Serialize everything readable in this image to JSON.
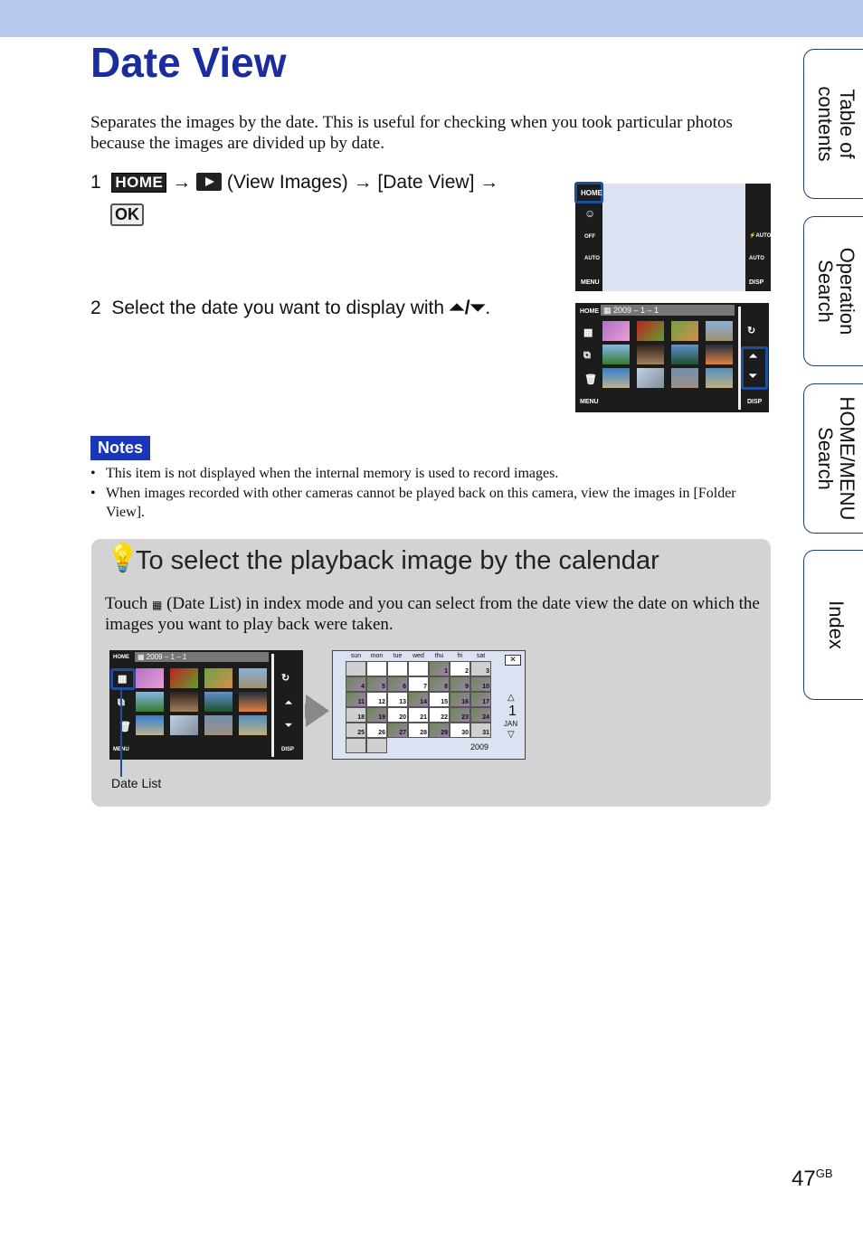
{
  "page": {
    "title": "Date View",
    "intro": "Separates the images by the date. This is useful for checking when you took particular photos because the images are divided up by date.",
    "page_number": "47",
    "page_suffix": "GB"
  },
  "steps": [
    {
      "num": "1",
      "home_key": "HOME",
      "arrow": "→",
      "view_images": "(View Images)",
      "date_view": "[Date View]",
      "ok_key": "OK"
    },
    {
      "num": "2",
      "text": "Select the date you want to display with",
      "buttons": "⏶/⏷",
      "end": "."
    }
  ],
  "screen1": {
    "home": "HOME",
    "menu": "MENU",
    "disp": "DISP",
    "flash": "⚡AUTO",
    "wb": "AUTO",
    "smile": "☺",
    "selftimer": "OFF",
    "iso": "AUTO"
  },
  "screen2": {
    "home": "HOME",
    "date": "2009 – 1 – 1",
    "menu": "MENU",
    "disp": "DISP"
  },
  "notes": {
    "label": "Notes",
    "items": [
      "This item is not displayed when the internal memory is used to record images.",
      "When images recorded with other cameras cannot be played back on this camera, view the images in [Folder View]."
    ]
  },
  "tip": {
    "title": "To select the playback image by the calendar",
    "text_before": "Touch",
    "text_after": "(Date List) in index mode and you can select from the date view the date on which the images you want to play back were taken.",
    "callout": "Date List"
  },
  "calendar": {
    "days": [
      "sun",
      "mon",
      "tue",
      "wed",
      "thu",
      "fri",
      "sat"
    ],
    "year": "2009",
    "month": "JAN",
    "month_num": "1",
    "up": "△",
    "down": "▽",
    "close": "✕",
    "weeks": [
      [
        "",
        "",
        "",
        "",
        "1",
        "2",
        "3"
      ],
      [
        "4",
        "5",
        "6",
        "7",
        "8",
        "9",
        "10"
      ],
      [
        "11",
        "12",
        "13",
        "14",
        "15",
        "16",
        "17"
      ],
      [
        "18",
        "19",
        "20",
        "21",
        "22",
        "23",
        "24"
      ],
      [
        "25",
        "26",
        "27",
        "28",
        "29",
        "30",
        "31"
      ],
      [
        "",
        ""
      ]
    ],
    "photo_days": [
      "1",
      "4",
      "5",
      "6",
      "8",
      "9",
      "10",
      "11",
      "14",
      "16",
      "17",
      "19",
      "23",
      "24",
      "27",
      "29"
    ]
  },
  "tabs": [
    "Table of\ncontents",
    "Operation\nSearch",
    "HOME/MENU\nSearch",
    "Index"
  ],
  "colors": {
    "title": "#1b2d9e",
    "highlight": "#1f4f9a",
    "notes_bg": "#1b35b8",
    "tip_bg": "#d3d3d3",
    "band": "#b9c9ee"
  }
}
